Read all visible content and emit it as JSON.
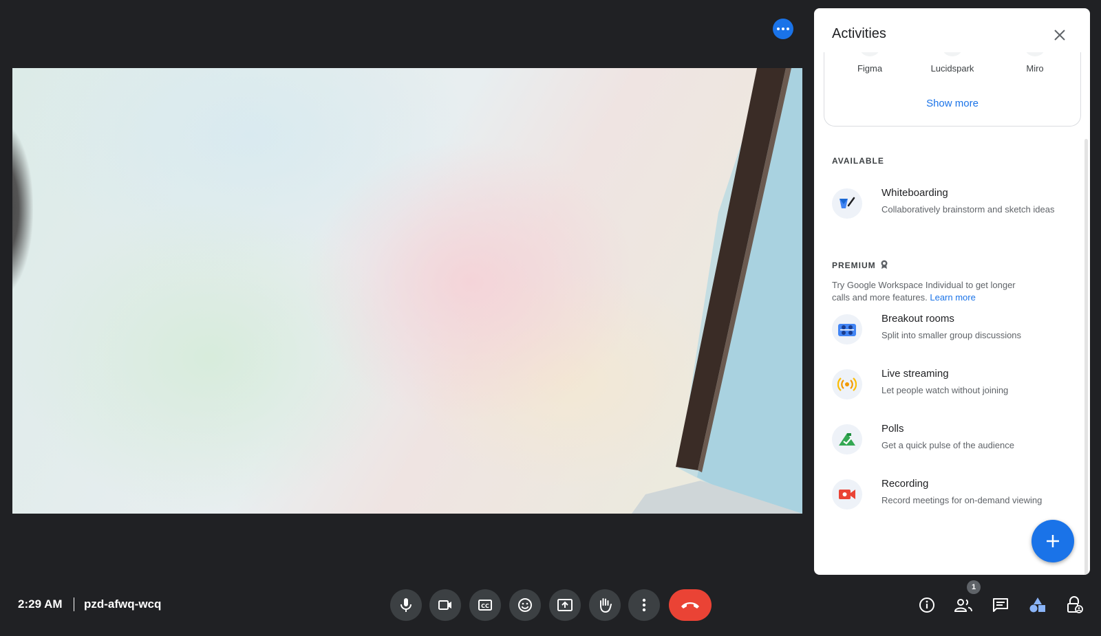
{
  "meeting": {
    "time": "2:29 AM",
    "code": "pzd-afwq-wcq",
    "participant_count": "1"
  },
  "panel": {
    "title": "Activities",
    "apps": [
      {
        "label": "Figma"
      },
      {
        "label": "Lucidspark"
      },
      {
        "label": "Miro"
      }
    ],
    "show_more": "Show more",
    "available_label": "AVAILABLE",
    "available": [
      {
        "title": "Whiteboarding",
        "description": "Collaboratively brainstorm and sketch ideas",
        "icon": "whiteboard-icon"
      }
    ],
    "premium_label": "PREMIUM",
    "premium_note": "Try Google Workspace Individual to get longer calls and more features.",
    "learn_more": "Learn more",
    "premium": [
      {
        "title": "Breakout rooms",
        "description": "Split into smaller group discussions",
        "icon": "breakout-rooms-icon"
      },
      {
        "title": "Live streaming",
        "description": "Let people watch without joining",
        "icon": "live-streaming-icon"
      },
      {
        "title": "Polls",
        "description": "Get a quick pulse of the audience",
        "icon": "polls-icon"
      },
      {
        "title": "Recording",
        "description": "Record meetings for on-demand viewing",
        "icon": "recording-icon"
      }
    ]
  },
  "controls": {
    "center": [
      "microphone-icon",
      "camera-icon",
      "captions-icon",
      "emoji-icon",
      "present-icon",
      "raise-hand-icon",
      "more-options-icon",
      "end-call-icon"
    ],
    "right": [
      "meeting-details-icon",
      "people-icon",
      "chat-icon",
      "activities-icon",
      "host-controls-icon"
    ]
  },
  "colors": {
    "background": "#202124",
    "accent": "#1a73e8",
    "end_call": "#ea4335",
    "control_bg": "#3c4043"
  }
}
